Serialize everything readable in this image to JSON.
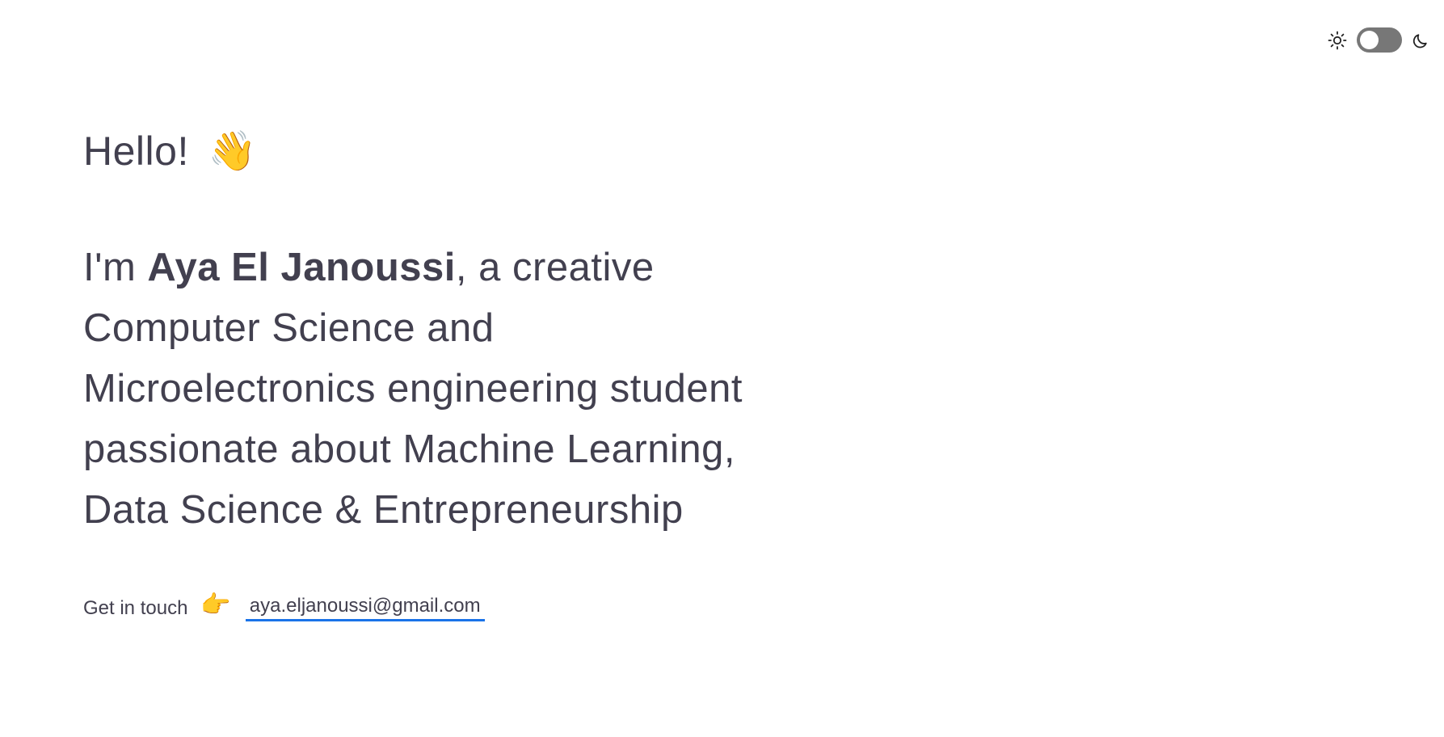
{
  "theme": {
    "light_icon": "sun-icon",
    "dark_icon": "moon-icon",
    "toggle_state": "light"
  },
  "hero": {
    "greeting": "Hello!",
    "wave_emoji": "👋",
    "intro_prefix": "I'm ",
    "name": "Aya El Janoussi",
    "intro_suffix": ", a creative Computer Science and Microelectronics engineering student passionate about Machine Learning, Data Science & Entrepreneurship"
  },
  "contact": {
    "label": "Get in touch",
    "pointer_emoji": "👉",
    "email": "aya.eljanoussi@gmail.com",
    "link_color": "#1a73e8"
  },
  "colors": {
    "text": "#42404f",
    "background": "#ffffff",
    "toggle_track": "#777777"
  }
}
